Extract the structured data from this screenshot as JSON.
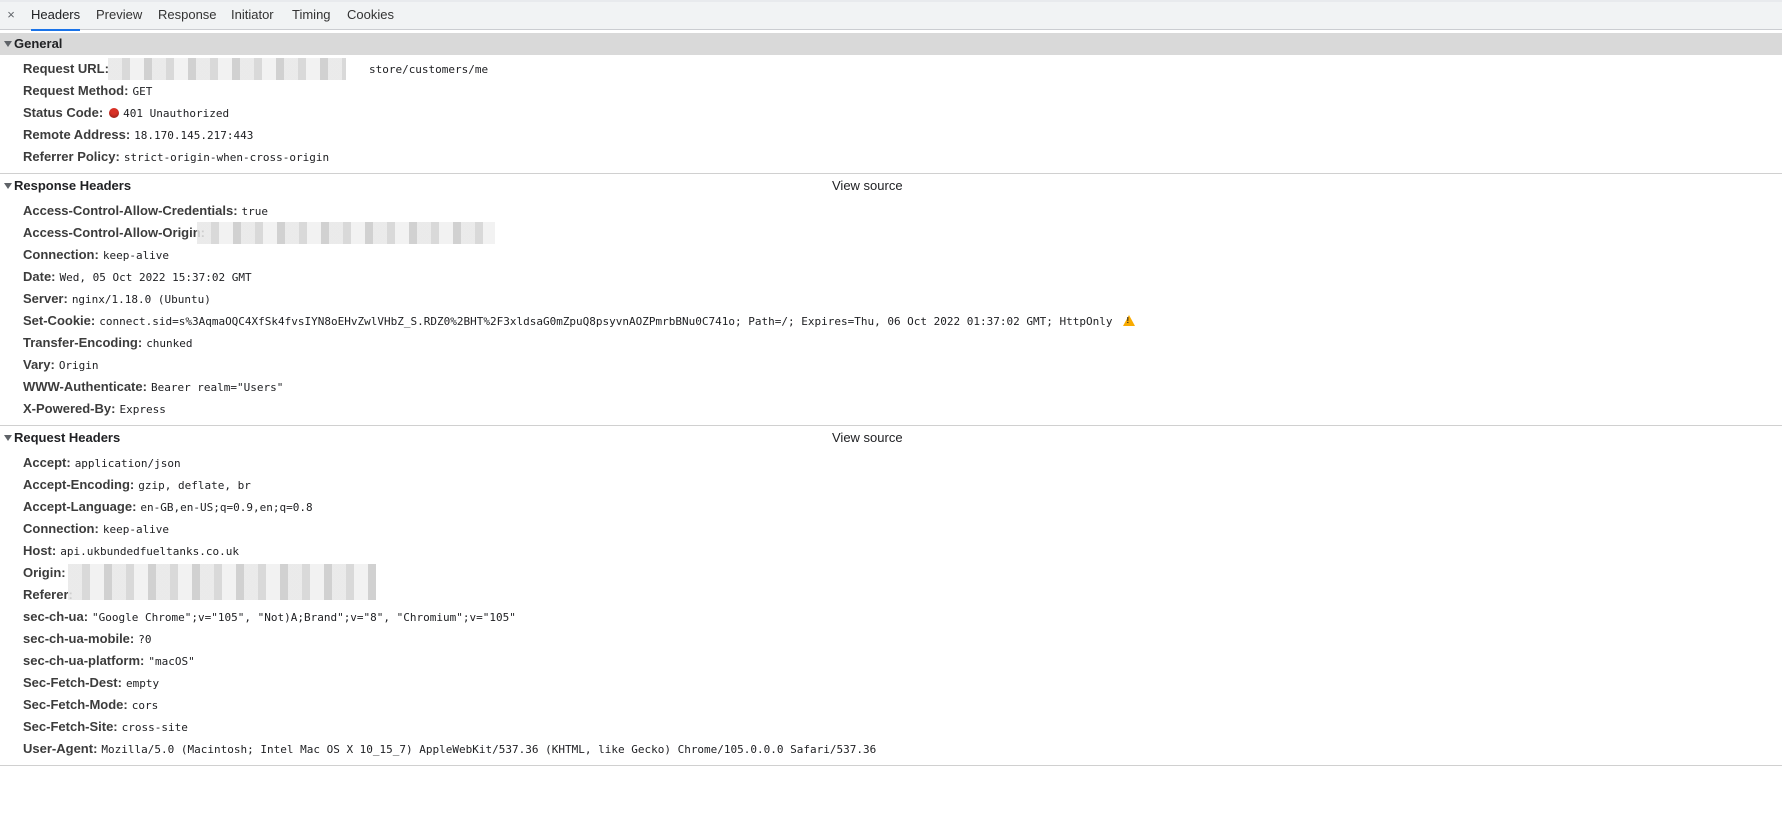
{
  "tabs": {
    "close_symbol": "×",
    "items": [
      "Headers",
      "Preview",
      "Response",
      "Initiator",
      "Timing",
      "Cookies"
    ]
  },
  "general": {
    "title": "General",
    "rows": [
      {
        "key": "Request URL:",
        "value": "store/customers/me"
      },
      {
        "key": "Request Method:",
        "value": "GET"
      },
      {
        "key": "Status Code:",
        "value": "401 Unauthorized"
      },
      {
        "key": "Remote Address:",
        "value": "18.170.145.217:443"
      },
      {
        "key": "Referrer Policy:",
        "value": "strict-origin-when-cross-origin"
      }
    ]
  },
  "response_headers": {
    "title": "Response Headers",
    "view_source": "View source",
    "rows": [
      {
        "key": "Access-Control-Allow-Credentials:",
        "value": "true"
      },
      {
        "key": "Access-Control-Allow-Origin:",
        "value": ""
      },
      {
        "key": "Connection:",
        "value": "keep-alive"
      },
      {
        "key": "Date:",
        "value": "Wed, 05 Oct 2022 15:37:02 GMT"
      },
      {
        "key": "Server:",
        "value": "nginx/1.18.0 (Ubuntu)"
      },
      {
        "key": "Set-Cookie:",
        "value": "connect.sid=s%3AqmaOQC4XfSk4fvsIYN8oEHvZwlVHbZ_S.RDZ0%2BHT%2F3xldsaG0mZpuQ8psyvnAOZPmrbBNu0C741o; Path=/; Expires=Thu, 06 Oct 2022 01:37:02 GMT; HttpOnly"
      },
      {
        "key": "Transfer-Encoding:",
        "value": "chunked"
      },
      {
        "key": "Vary:",
        "value": "Origin"
      },
      {
        "key": "WWW-Authenticate:",
        "value": "Bearer realm=\"Users\""
      },
      {
        "key": "X-Powered-By:",
        "value": "Express"
      }
    ]
  },
  "request_headers": {
    "title": "Request Headers",
    "view_source": "View source",
    "rows": [
      {
        "key": "Accept:",
        "value": "application/json"
      },
      {
        "key": "Accept-Encoding:",
        "value": "gzip, deflate, br"
      },
      {
        "key": "Accept-Language:",
        "value": "en-GB,en-US;q=0.9,en;q=0.8"
      },
      {
        "key": "Connection:",
        "value": "keep-alive"
      },
      {
        "key": "Host:",
        "value": "api.ukbundedfueltanks.co.uk"
      },
      {
        "key": "Origin:",
        "value": ""
      },
      {
        "key": "Referer:",
        "value": ""
      },
      {
        "key": "sec-ch-ua:",
        "value": "\"Google Chrome\";v=\"105\", \"Not)A;Brand\";v=\"8\", \"Chromium\";v=\"105\""
      },
      {
        "key": "sec-ch-ua-mobile:",
        "value": "?0"
      },
      {
        "key": "sec-ch-ua-platform:",
        "value": "\"macOS\""
      },
      {
        "key": "Sec-Fetch-Dest:",
        "value": "empty"
      },
      {
        "key": "Sec-Fetch-Mode:",
        "value": "cors"
      },
      {
        "key": "Sec-Fetch-Site:",
        "value": "cross-site"
      },
      {
        "key": "User-Agent:",
        "value": "Mozilla/5.0 (Macintosh; Intel Mac OS X 10_15_7) AppleWebKit/537.36 (KHTML, like Gecko) Chrome/105.0.0.0 Safari/537.36"
      }
    ]
  },
  "colors": {
    "tab_active": "#1a73e8",
    "status_error": "#d93025",
    "warning": "#f9ab00"
  }
}
